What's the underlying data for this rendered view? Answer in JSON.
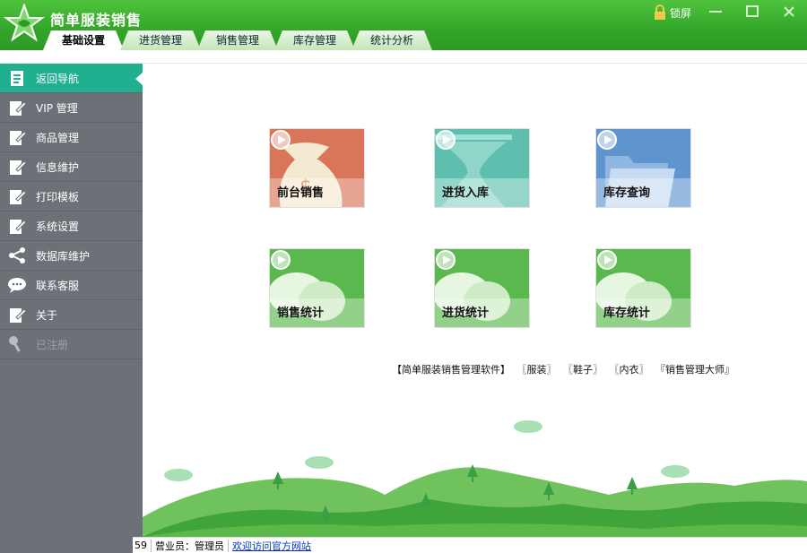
{
  "app": {
    "title": "简单服装销售"
  },
  "window": {
    "lock_label": "锁屏",
    "minimize": "minimize-icon",
    "maximize": "maximize-icon",
    "close": "close-icon"
  },
  "tabs": [
    {
      "label": "基础设置",
      "active": true
    },
    {
      "label": "进货管理",
      "active": false
    },
    {
      "label": "销售管理",
      "active": false
    },
    {
      "label": "库存管理",
      "active": false
    },
    {
      "label": "统计分析",
      "active": false
    }
  ],
  "sidebar": {
    "items": [
      {
        "label": "返回导航",
        "icon": "document-icon",
        "active": true
      },
      {
        "label": "VIP 管理",
        "icon": "edit-icon"
      },
      {
        "label": "商品管理",
        "icon": "edit-icon"
      },
      {
        "label": "信息维护",
        "icon": "edit-icon"
      },
      {
        "label": "打印模板",
        "icon": "edit-icon"
      },
      {
        "label": "系统设置",
        "icon": "edit-icon"
      },
      {
        "label": "数据库维护",
        "icon": "share-icon"
      },
      {
        "label": "联系客服",
        "icon": "chat-icon"
      },
      {
        "label": "关于",
        "icon": "edit-icon"
      },
      {
        "label": "已注册",
        "icon": "key-icon",
        "disabled": true
      }
    ]
  },
  "tiles": [
    {
      "label": "前台销售",
      "color": "#d9765a",
      "icon": "money-bag-icon"
    },
    {
      "label": "进货入库",
      "color": "#5fbfae",
      "icon": "hourglass-icon"
    },
    {
      "label": "库存查询",
      "color": "#5f95cf",
      "icon": "folder-icon"
    },
    {
      "label": "销售统计",
      "color": "#5ab84e",
      "icon": "chat-bubble-icon"
    },
    {
      "label": "进货统计",
      "color": "#5ab84e",
      "icon": "chat-bubble-icon"
    },
    {
      "label": "库存统计",
      "color": "#5ab84e",
      "icon": "chat-bubble-icon"
    }
  ],
  "links": [
    "【简单服装销售管理软件】",
    "〖服装〗",
    "〖鞋子〗",
    "〖内衣〗",
    "『销售管理大师』"
  ],
  "status": {
    "count": "59",
    "operator": "营业员：管理员",
    "website_link": "欢迎访问官方网站"
  },
  "colors": {
    "titlebar": "#33a52a",
    "sidebar": "#6b7177",
    "active": "#20b090"
  }
}
